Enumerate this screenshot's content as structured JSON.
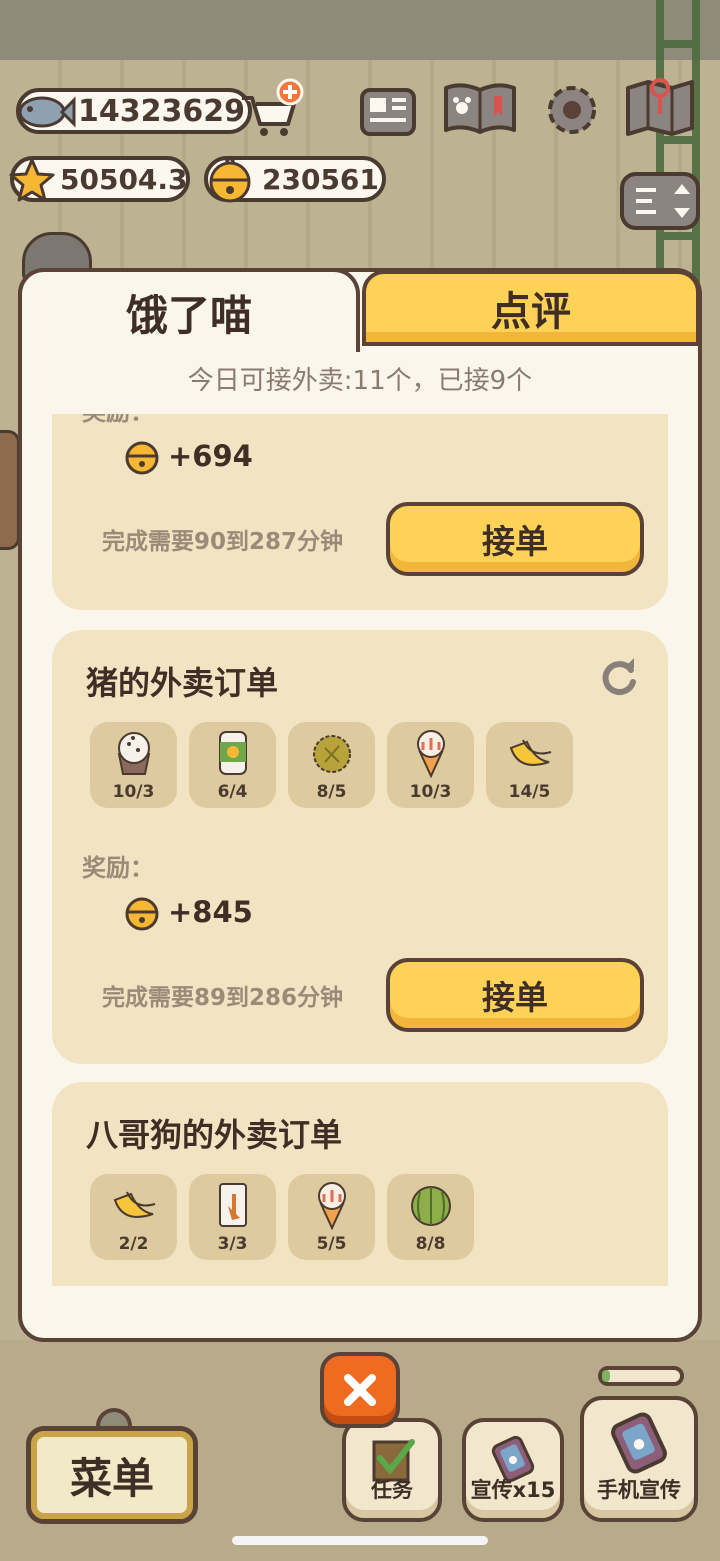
{
  "hud": {
    "fish": "14323629",
    "stars": "50504.3",
    "bells": "230561",
    "icons": [
      "fish-icon",
      "star-icon",
      "bell-icon",
      "cart-plus-icon",
      "newspaper-icon",
      "pawprint-book-icon",
      "gear-icon",
      "map-icon",
      "sort-icon"
    ]
  },
  "tabs": {
    "active": "饿了喵",
    "inactive": "点评"
  },
  "quota_text": "今日可接外卖:11个，已接9个",
  "orders": [
    {
      "title": "",
      "reward_label": "奖励：",
      "reward_value": "+694",
      "time": "完成需要90到287分钟",
      "accept": "接单"
    },
    {
      "title": "猪的外卖订单",
      "items": [
        {
          "icon": "cupcake-icon",
          "count": "10/3"
        },
        {
          "icon": "canned-food-icon",
          "count": "6/4"
        },
        {
          "icon": "durian-icon",
          "count": "8/5"
        },
        {
          "icon": "ice-cream-cone-icon",
          "count": "10/3"
        },
        {
          "icon": "banana-icon",
          "count": "14/5"
        }
      ],
      "reward_label": "奖励：",
      "reward_value": "+845",
      "time": "完成需要89到286分钟",
      "accept": "接单"
    },
    {
      "title": "八哥狗的外卖订单",
      "items": [
        {
          "icon": "banana-icon",
          "count": "2/2"
        },
        {
          "icon": "snack-bag-icon",
          "count": "3/3"
        },
        {
          "icon": "ice-cream-cone-icon",
          "count": "5/5"
        },
        {
          "icon": "watermelon-icon",
          "count": "8/8"
        }
      ]
    }
  ],
  "bottom": {
    "menu": "菜单",
    "task": "任务",
    "promo": "宣传x15",
    "phone_promo": "手机宣传",
    "phone_progress": 0.1
  },
  "colors": {
    "accent_yellow": "#fdd257",
    "close_orange": "#ef6b1f",
    "card_bg": "#f2e4c3",
    "panel_bg": "#fbf6ec",
    "border_brown": "#5a4236"
  }
}
